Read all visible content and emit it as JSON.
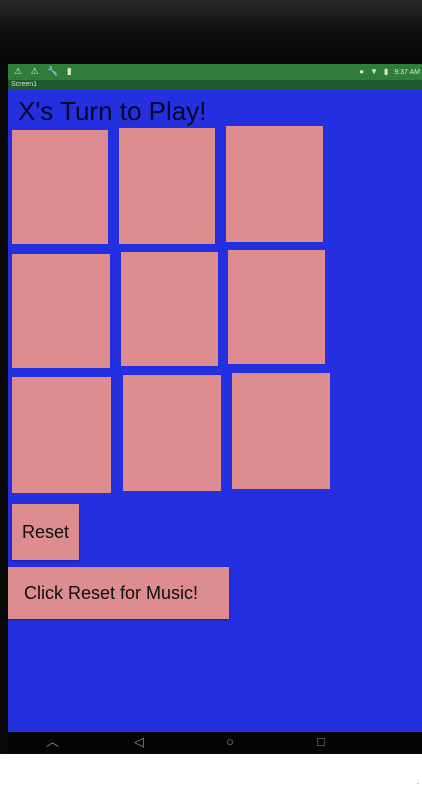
{
  "status_bar": {
    "left_icons": "⚠ ⚠ 🔧 ▮",
    "signal_icon": "●",
    "wifi_icon": "▼",
    "battery_icon": "▮",
    "time": "9:37 AM"
  },
  "screen": {
    "title": "Screen1"
  },
  "game": {
    "turn_label": "X's Turn to Play!",
    "cells": [
      "",
      "",
      "",
      "",
      "",
      "",
      "",
      "",
      ""
    ]
  },
  "buttons": {
    "reset_label": "Reset",
    "music_label": "Click Reset for Music!"
  },
  "nav": {
    "home_up": "︿",
    "back": "◁",
    "home": "○",
    "recents": "□"
  },
  "colors": {
    "app_background": "#2430e0",
    "cell": "#dd8d8f",
    "status_bar": "#2e7d3a"
  }
}
